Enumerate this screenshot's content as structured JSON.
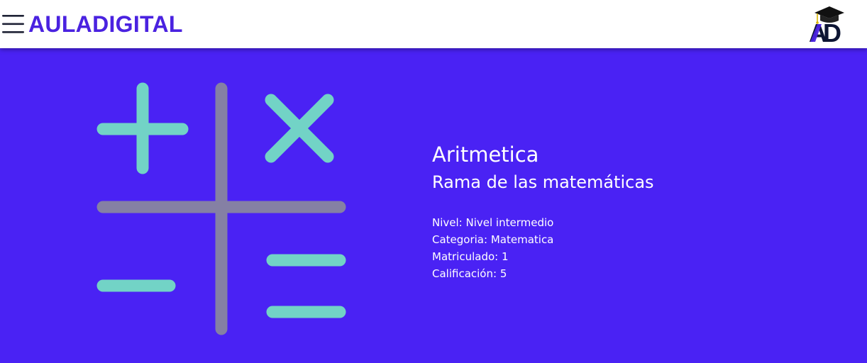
{
  "header": {
    "brand": "AULADIGITAL",
    "logo_text": "AD"
  },
  "course": {
    "title": "Aritmetica",
    "subtitle": "Rama de las matemáticas",
    "details": [
      {
        "label": "Nivel:",
        "value": "Nivel intermedio"
      },
      {
        "label": "Categoria:",
        "value": "Matematica"
      },
      {
        "label": "Matriculado:",
        "value": "1"
      },
      {
        "label": "Calificación:",
        "value": "5"
      }
    ]
  },
  "icons": {
    "menu": "hamburger-menu-icon",
    "logo": "graduation-cap-logo",
    "illustration": "math-operators-illustration"
  },
  "colors": {
    "brand": "#4a22e0",
    "hero_background": "#4a22f4",
    "operator_teal": "#72d3c6",
    "divider_gray": "#8580a4",
    "logo_dark": "#0d1533"
  }
}
